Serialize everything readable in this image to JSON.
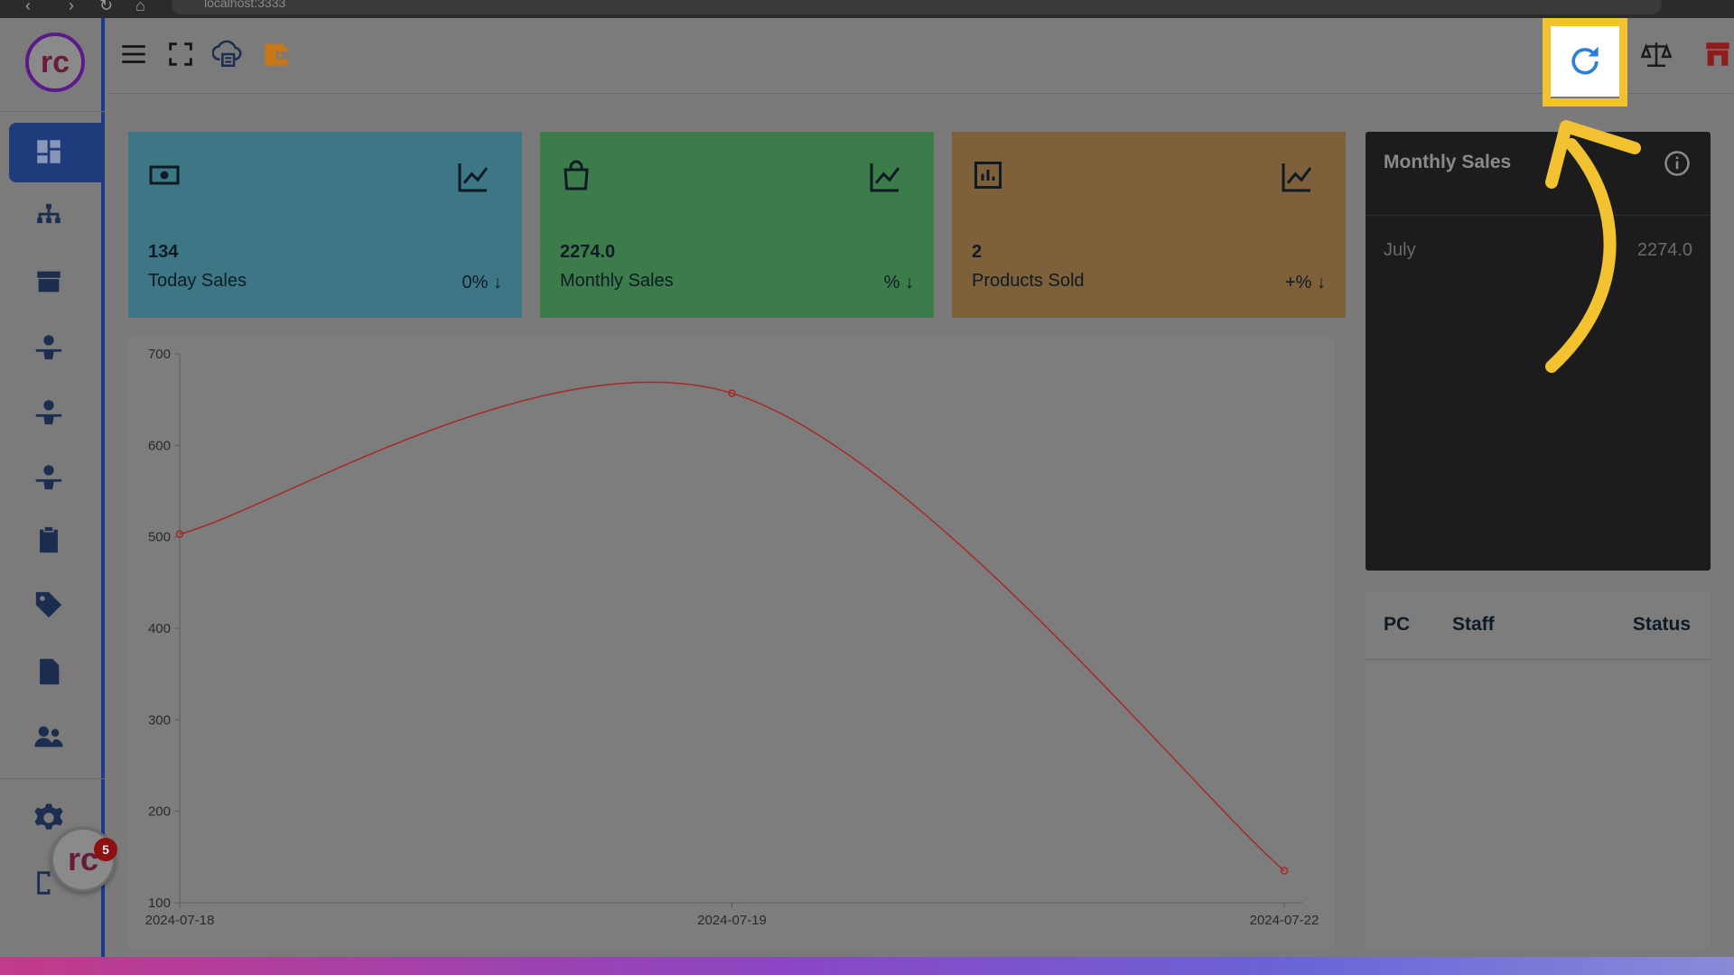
{
  "browser": {
    "url": "localhost:3333"
  },
  "brand": {
    "logo_text": "rc",
    "fab_text": "rc",
    "notification_count": "5"
  },
  "sidebar": {
    "items": [
      {
        "name": "dashboard",
        "active": true
      },
      {
        "name": "sitemap"
      },
      {
        "name": "store"
      },
      {
        "name": "user-a"
      },
      {
        "name": "user-b"
      },
      {
        "name": "user-c"
      },
      {
        "name": "clipboard"
      },
      {
        "name": "tags"
      },
      {
        "name": "document"
      },
      {
        "name": "users"
      },
      {
        "name": "settings"
      }
    ]
  },
  "topbar": {
    "left_icons": [
      "menu-icon",
      "fullscreen-icon",
      "cloud-print-icon",
      "wallet-icon"
    ],
    "right_icons": [
      "refresh-icon",
      "scale-icon",
      "store-icon"
    ]
  },
  "cards": [
    {
      "value": "134",
      "label": "Today Sales",
      "pct": "0%",
      "color": "#3d7786"
    },
    {
      "value": "2274.0",
      "label": "Monthly Sales",
      "pct": "%",
      "color": "#3c7c4a"
    },
    {
      "value": "2",
      "label": "Products Sold",
      "pct": "+%",
      "color": "#7e603b"
    }
  ],
  "chart_data": {
    "type": "line",
    "x": [
      "2024-07-18",
      "2024-07-19",
      "2024-07-22"
    ],
    "values": [
      503,
      657,
      135
    ],
    "ylim": [
      100,
      700
    ],
    "yticks": [
      100,
      200,
      300,
      400,
      500,
      600,
      700
    ],
    "line_color": "#a52a2a",
    "grid": false
  },
  "monthly_sales": {
    "title": "Monthly Sales",
    "month": "July",
    "amount": "2274.0"
  },
  "staff_table": {
    "headers": [
      "PC",
      "Staff",
      "Status"
    ]
  },
  "colors": {
    "highlight": "#f2c230",
    "refresh_icon": "#2a7fd8",
    "sidebar_border": "#1f3a8a"
  }
}
